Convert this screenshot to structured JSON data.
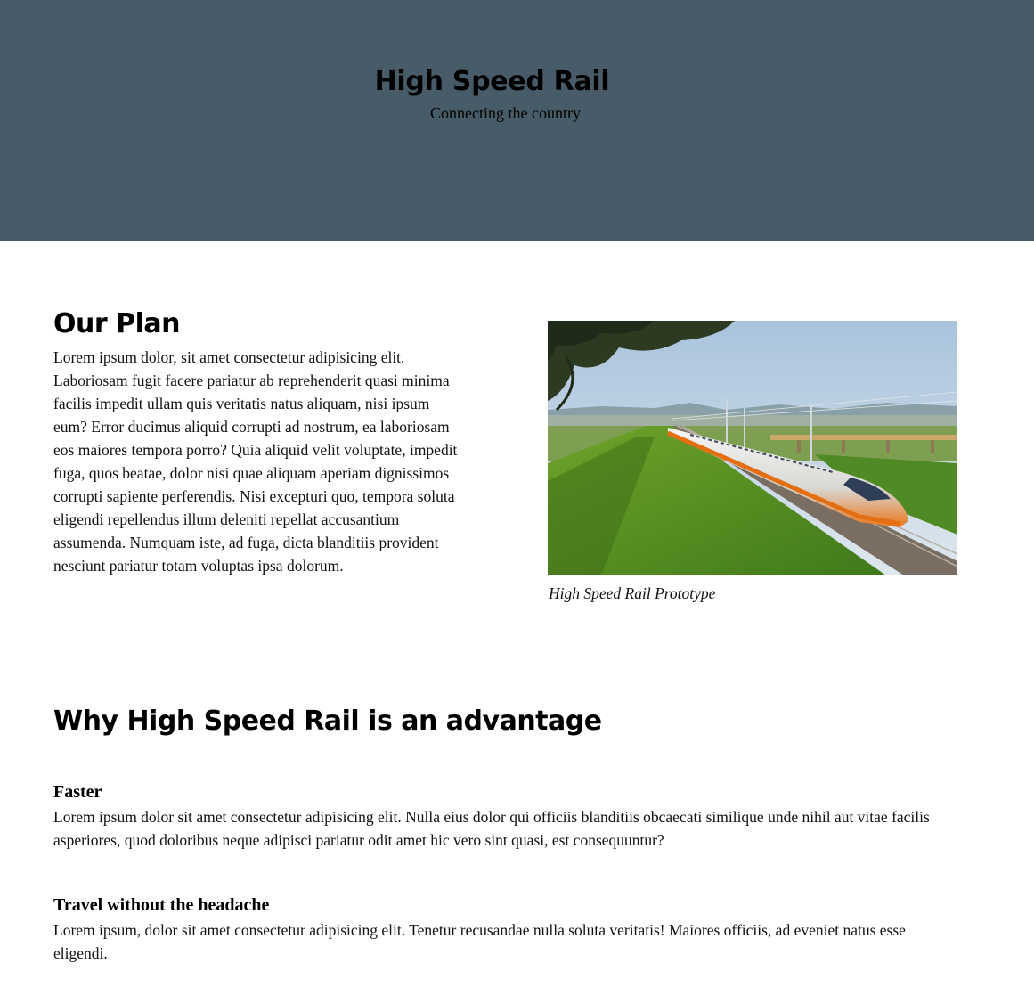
{
  "hero": {
    "title": "High Speed Rail",
    "subtitle": "Connecting the country",
    "background_color": "#485b68"
  },
  "plan": {
    "heading": "Our Plan",
    "body": "Lorem ipsum dolor, sit amet consectetur adipisicing elit. Laboriosam fugit facere pariatur ab reprehenderit quasi minima facilis impedit ullam quis veritatis natus aliquam, nisi ipsum eum? Error ducimus aliquid corrupti ad nostrum, ea laboriosam eos maiores tempora porro? Quia aliquid velit voluptate, impedit fuga, quos beatae, dolor nisi quae aliquam aperiam dignissimos corrupti sapiente perferendis. Nisi excepturi quo, tempora soluta eligendi repellendus illum deleniti repellat accusantium assumenda. Numquam iste, ad fuga, dicta blanditiis provident nesciunt pariatur totam voluptas ipsa dolorum.",
    "image_caption": "High Speed Rail Prototype"
  },
  "advantages": {
    "heading": "Why High Speed Rail is an advantage",
    "items": [
      {
        "title": "Faster",
        "body": "Lorem ipsum dolor sit amet consectetur adipisicing elit. Nulla eius dolor qui officiis blanditiis obcaecati similique unde nihil aut vitae facilis asperiores, quod doloribus neque adipisci pariatur odit amet hic vero sint quasi, est consequuntur?"
      },
      {
        "title": "Travel without the headache",
        "body": "Lorem ipsum, dolor sit amet consectetur adipisicing elit. Tenetur recusandae nulla soluta veritatis! Maiores officiis, ad eveniet natus esse eligendi."
      }
    ]
  }
}
